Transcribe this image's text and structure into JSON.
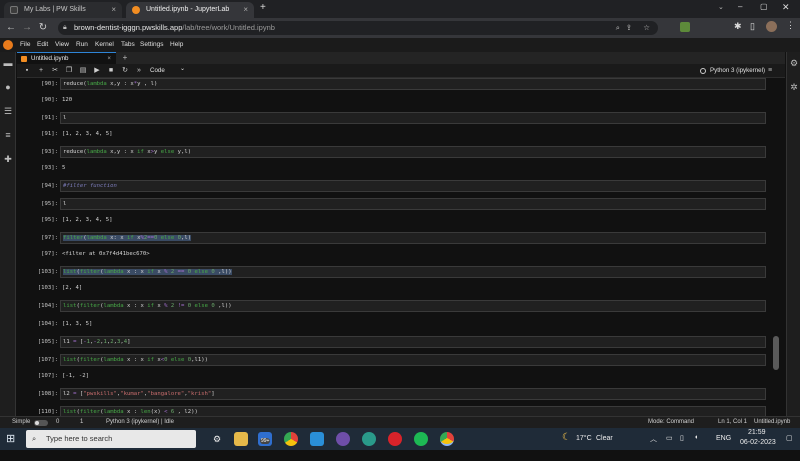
{
  "browser": {
    "tabs": [
      {
        "title": "My Labs | PW Skills",
        "close": "×"
      },
      {
        "title": "Untitled.ipynb - JupyterLab",
        "close": "×"
      }
    ],
    "new_tab": "+",
    "url_domain": "brown-dentist-igggn.pwskills.app",
    "url_path": "/lab/tree/work/Untitled.ipynb",
    "nav": {
      "back": "←",
      "forward": "→",
      "reload": "↻"
    }
  },
  "menu": [
    "File",
    "Edit",
    "View",
    "Run",
    "Kernel",
    "Tabs",
    "Settings",
    "Help"
  ],
  "notebook_tab": {
    "title": "Untitled.ipynb",
    "close": "×",
    "plus": "+"
  },
  "toolbar": {
    "cell_type": "Code",
    "chevron": "⌄",
    "kernel": "Python 3 (ipykernel)"
  },
  "cells": [
    {
      "kind": "in",
      "prompt": "[90]:",
      "code": "reduce(lambda x,y : x*y , l)"
    },
    {
      "kind": "out",
      "prompt": "[90]:",
      "text": "120"
    },
    {
      "kind": "in",
      "prompt": "[91]:",
      "code": "l"
    },
    {
      "kind": "out",
      "prompt": "[91]:",
      "text": "[1, 2, 3, 4, 5]"
    },
    {
      "kind": "in",
      "prompt": "[93]:",
      "code": "reduce(lambda x,y : x if x>y else y,l)"
    },
    {
      "kind": "out",
      "prompt": "[93]:",
      "text": "5"
    },
    {
      "kind": "in",
      "prompt": "[94]:",
      "code": "#filter function"
    },
    {
      "kind": "in",
      "prompt": "[95]:",
      "code": "l"
    },
    {
      "kind": "out",
      "prompt": "[95]:",
      "text": "[1, 2, 3, 4, 5]"
    },
    {
      "kind": "in",
      "prompt": "[97]:",
      "code": "filter(lambda x: x if x%2==0 else 0,l)"
    },
    {
      "kind": "out",
      "prompt": "[97]:",
      "text": "<filter at 0x7f4d41bec670>"
    },
    {
      "kind": "in",
      "prompt": "[103]:",
      "code": "list(filter(lambda x : x if x % 2 == 0 else 0 ,l))"
    },
    {
      "kind": "out",
      "prompt": "[103]:",
      "text": "[2, 4]"
    },
    {
      "kind": "in",
      "prompt": "[104]:",
      "code": "list(filter(lambda x : x if x % 2 != 0 else 0 ,l))"
    },
    {
      "kind": "out",
      "prompt": "[104]:",
      "text": "[1, 3, 5]"
    },
    {
      "kind": "in",
      "prompt": "[105]:",
      "code": "l1 = [-1,-2,1,2,3,4]"
    },
    {
      "kind": "in",
      "prompt": "[107]:",
      "code": "list(filter(lambda x : x if x<0 else 0,l1))"
    },
    {
      "kind": "out",
      "prompt": "[107]:",
      "text": "[-1, -2]"
    },
    {
      "kind": "in",
      "prompt": "[108]:",
      "code": "l2 = [\"pwskills\",\"kumar\",\"bangalore\",\"krish\"]"
    },
    {
      "kind": "in",
      "prompt": "[110]:",
      "code": "list(filter(lambda x : len(x) < 6 , l2))"
    }
  ],
  "status": {
    "mode_label": "Simple",
    "count_a": "0",
    "count_b": "1",
    "kernel_status": "Python 3 (ipykernel) | Idle",
    "mode": "Mode: Command",
    "position": "Ln 1, Col 1",
    "file": "Untitled.ipynb"
  },
  "taskbar": {
    "search_placeholder": "Type here to search",
    "badge": "99+",
    "weather_temp": "17°C",
    "weather_desc": "Clear",
    "lang": "ENG",
    "time": "21:59",
    "date": "06-02-2023"
  },
  "colors": {
    "jupyter_orange": "#f28d22",
    "taskbar": "#1f2b38",
    "accent": "#2e84d6"
  }
}
